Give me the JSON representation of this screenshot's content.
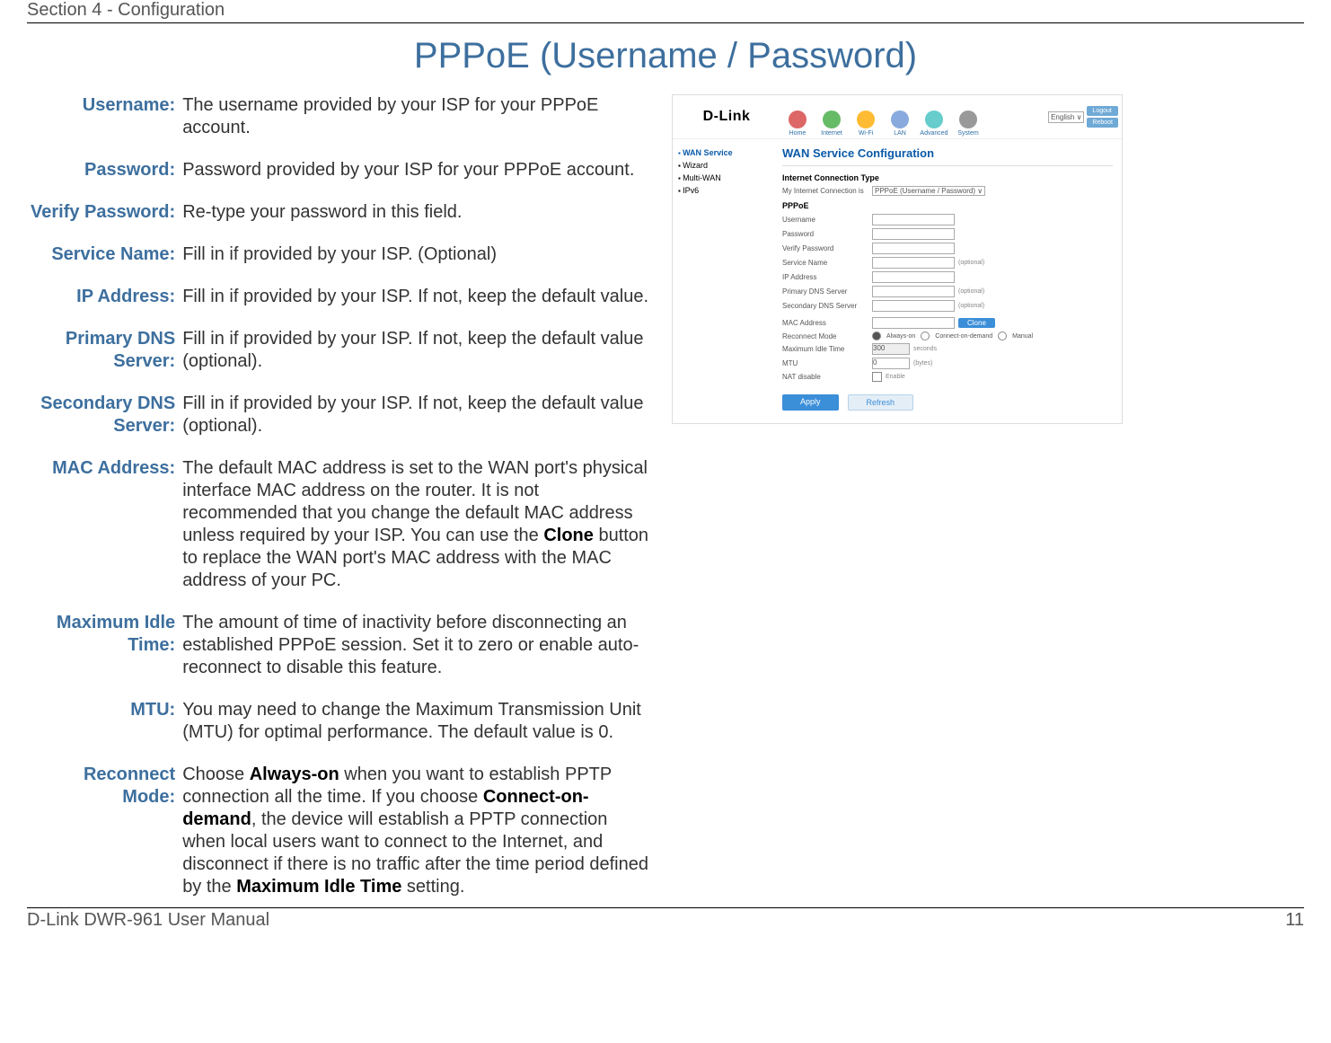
{
  "header": {
    "section": "Section 4 - Configuration"
  },
  "title": "PPPoE (Username / Password)",
  "defs": {
    "username": {
      "label": "Username:",
      "value": "The username provided by your ISP for your PPPoE account."
    },
    "password": {
      "label": "Password:",
      "value": "Password provided by your ISP for your PPPoE account."
    },
    "verify": {
      "label": "Verify Password:",
      "value": "Re-type your password in this field."
    },
    "service": {
      "label": "Service Name:",
      "value": "Fill in if provided by your ISP. (Optional)"
    },
    "ip": {
      "label": "IP Address:",
      "value": "Fill in if provided by your ISP. If not, keep the default value."
    },
    "pdns": {
      "label": "Primary DNS Server:",
      "value": "Fill in if provided by your ISP. If not, keep the default value (optional)."
    },
    "sdns": {
      "label": "Secondary DNS Server:",
      "value": "Fill in if provided by your ISP. If not, keep the default value (optional)."
    },
    "mac": {
      "label": "MAC Address:",
      "value_pre": "The default MAC address is set to the WAN port's physical interface MAC address on the router. It is not recommended that you change the default MAC address unless required by your ISP. You can use the ",
      "bold": "Clone",
      "value_post": " button to replace the WAN port's MAC address with the MAC address of your PC."
    },
    "idle": {
      "label": "Maximum Idle Time:",
      "value": "The amount of time of inactivity before disconnecting an established PPPoE session. Set it to zero or enable auto-reconnect to disable this feature."
    },
    "mtu": {
      "label": "MTU:",
      "value": "You may need to change the Maximum Transmission Unit (MTU) for optimal performance. The default value is 0."
    },
    "reconnect": {
      "label": "Reconnect Mode:",
      "p1": "Choose ",
      "b1": "Always-on",
      "p2": " when you want to establish PPTP connection all the time. If you choose ",
      "b2": "Connect-on-demand",
      "p3": ", the device will establish a PPTP connection when local users want to connect to the Internet, and disconnect if there is no traffic after the time period defined by the ",
      "b3": "Maximum Idle Time",
      "p4": " setting."
    }
  },
  "shot": {
    "logo": "D-Link",
    "nav": [
      "Home",
      "Internet",
      "Wi-Fi",
      "LAN",
      "Advanced",
      "System"
    ],
    "lang": "English",
    "top_btns": [
      "Logout",
      "Reboot"
    ],
    "side": [
      "WAN Service",
      "Wizard",
      "Multi-WAN",
      "IPv6"
    ],
    "main_title": "WAN Service Configuration",
    "sec1": "Internet Connection Type",
    "conn_label": "My Internet Connection is",
    "conn_value": "PPPoE (Username / Password)",
    "sec2": "PPPoE",
    "rows": {
      "user": "Username",
      "pass": "Password",
      "verify": "Verify Password",
      "svc": "Service Name",
      "ip": "IP Address",
      "pdns": "Primary DNS Server",
      "sdns": "Secondary DNS Server",
      "mac": "MAC Address",
      "clone": "Clone",
      "reconn": "Reconnect Mode",
      "opt_always": "Always-on",
      "opt_demand": "Connect-on-demand",
      "opt_manual": "Manual",
      "idle": "Maximum Idle Time",
      "idle_val": "300",
      "idle_hint": "seconds",
      "mtu": "MTU",
      "mtu_val": "0",
      "mtu_hint": "(bytes)",
      "nat": "NAT disable",
      "nat_hint": "Enable",
      "opt_hint": "(optional)"
    },
    "btns": {
      "apply": "Apply",
      "refresh": "Refresh"
    }
  },
  "footer": {
    "manual": "D-Link DWR-961 User Manual",
    "page": "11"
  }
}
